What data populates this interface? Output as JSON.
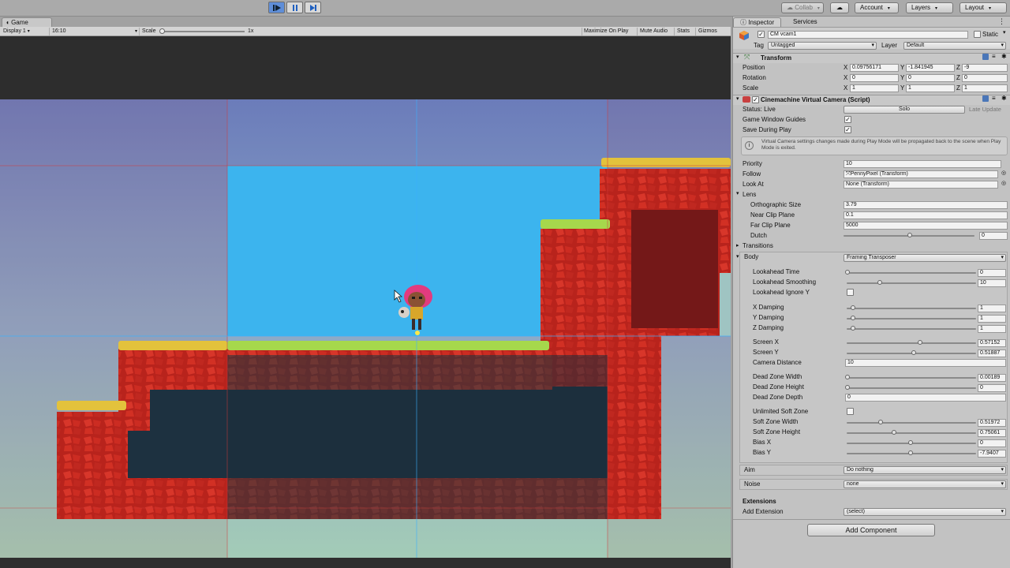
{
  "toolbar": {
    "play_controls": [
      "play",
      "pause",
      "step"
    ],
    "collab": "Collab",
    "account": "Account",
    "layers": "Layers",
    "layout": "Layout"
  },
  "game_tab": {
    "title": "Game",
    "display": "Display 1",
    "aspect": "16:10",
    "scale_label": "Scale",
    "scale_value": "1x",
    "maximize": "Maximize On Play",
    "mute": "Mute Audio",
    "stats": "Stats",
    "gizmos": "Gizmos"
  },
  "inspector": {
    "tabs": [
      "Inspector",
      "Services"
    ],
    "object_name": "CM vcam1",
    "static_label": "Static",
    "tag_label": "Tag",
    "tag_value": "Untagged",
    "layer_label": "Layer",
    "layer_value": "Default",
    "transform": {
      "title": "Transform",
      "position_label": "Position",
      "rotation_label": "Rotation",
      "scale_label": "Scale",
      "position": {
        "x": "0.09756171",
        "y": "-1.841945",
        "z": "-9"
      },
      "rotation": {
        "x": "0",
        "y": "0",
        "z": "0"
      },
      "scale": {
        "x": "1",
        "y": "1",
        "z": "1"
      }
    },
    "vcam": {
      "title": "Cinemachine Virtual Camera (Script)",
      "status_label": "Status: Live",
      "solo": "Solo",
      "late_update": "Late Update",
      "game_window_guides": "Game Window Guides",
      "save_during_play": "Save During Play",
      "info_text": "Virtual Camera settings changes made during Play Mode will be propagated back to the scene when Play Mode is exited.",
      "priority_label": "Priority",
      "priority_value": "10",
      "follow_label": "Follow",
      "follow_value": "PennyPixel (Transform)",
      "look_at_label": "Look At",
      "look_at_value": "None (Transform)",
      "lens_label": "Lens",
      "ortho_label": "Orthographic Size",
      "ortho_value": "3.79",
      "near_label": "Near Clip Plane",
      "near_value": "0.1",
      "far_label": "Far Clip Plane",
      "far_value": "5000",
      "dutch_label": "Dutch",
      "dutch_value": "0",
      "transitions_label": "Transitions",
      "body_label": "Body",
      "body_value": "Framing Transposer",
      "lookahead_time_label": "Lookahead Time",
      "lookahead_time_value": "0",
      "lookahead_smoothing_label": "Lookahead Smoothing",
      "lookahead_smoothing_value": "10",
      "lookahead_ignore_y_label": "Lookahead Ignore Y",
      "x_damping_label": "X Damping",
      "x_damping_value": "1",
      "y_damping_label": "Y Damping",
      "y_damping_value": "1",
      "z_damping_label": "Z Damping",
      "z_damping_value": "1",
      "screen_x_label": "Screen X",
      "screen_x_value": "0.57152",
      "screen_y_label": "Screen Y",
      "screen_y_value": "0.51887",
      "camera_distance_label": "Camera Distance",
      "camera_distance_value": "10",
      "dead_zone_width_label": "Dead Zone Width",
      "dead_zone_width_value": "0.00189",
      "dead_zone_height_label": "Dead Zone Height",
      "dead_zone_height_value": "0",
      "dead_zone_depth_label": "Dead Zone Depth",
      "dead_zone_depth_value": "0",
      "unlimited_soft_zone_label": "Unlimited Soft Zone",
      "soft_zone_width_label": "Soft Zone Width",
      "soft_zone_width_value": "0.51972",
      "soft_zone_height_label": "Soft Zone Height",
      "soft_zone_height_value": "0.75061",
      "bias_x_label": "Bias X",
      "bias_x_value": "0",
      "bias_y_label": "Bias Y",
      "bias_y_value": "-7.9407",
      "aim_label": "Aim",
      "aim_value": "Do nothing",
      "noise_label": "Noise",
      "noise_value": "none",
      "extensions_label": "Extensions",
      "add_extension_label": "Add Extension",
      "add_extension_value": "(select)"
    },
    "add_component": "Add Component"
  },
  "colors": {
    "sky_top": "#6a7ab8",
    "sky_mid": "#8aa8c4",
    "sky_bottom": "#9fc9b8",
    "dead_zone": "#40b4ec",
    "grass": "#a5d64a",
    "grass_yellow": "#e0c03a",
    "rock": "#c7261d",
    "rock_dark": "#6e1414",
    "cave_dark": "#1f3442",
    "guide_red": "#d23a3a",
    "guide_blue": "#3ab0ff"
  }
}
